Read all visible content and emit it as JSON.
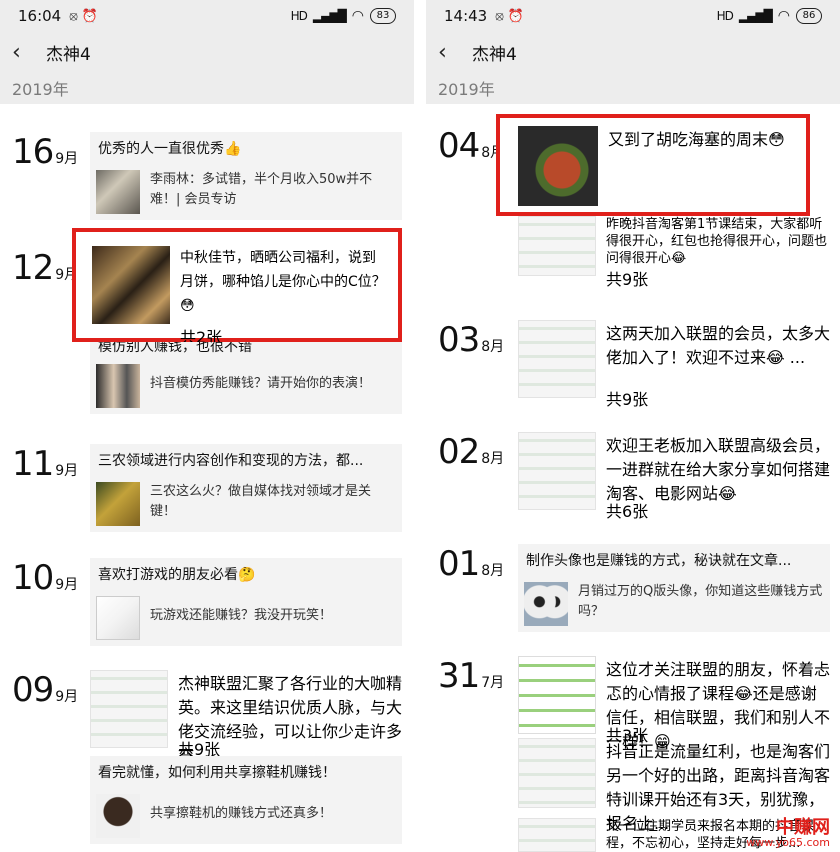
{
  "left": {
    "status": {
      "time": "16:04",
      "battery": "83",
      "net": "HD"
    },
    "nav": {
      "title": "杰神4"
    },
    "year": "2019年",
    "posts": [
      {
        "day": "16",
        "month": "9月",
        "title": "优秀的人一直很优秀👍",
        "share_text": "李雨林：多试错，半个月收入50w并不难！| 会员专访"
      },
      {
        "day": "12",
        "month": "9月",
        "text": "中秋佳节，晒晒公司福利，说到月饼，哪种馅儿是你心中的C位？😳",
        "count": "共2张"
      },
      {
        "title": "模仿别人赚钱，也很不错",
        "share_text": "抖音模仿秀能赚钱？请开始你的表演！"
      },
      {
        "day": "11",
        "month": "9月",
        "title": "三农领域进行内容创作和变现的方法，都...",
        "share_text": "三农这么火？做自媒体找对领域才是关键！"
      },
      {
        "day": "10",
        "month": "9月",
        "title": "喜欢打游戏的朋友必看🤔",
        "share_text": "玩游戏还能赚钱？我没开玩笑！"
      },
      {
        "day": "09",
        "month": "9月",
        "text": "杰神联盟汇聚了各行业的大咖精英。来这里结识优质人脉，与大佬交流经验，可以让你少走许多弯...",
        "count": "共9张"
      },
      {
        "title": "看完就懂，如何利用共享擦鞋机赚钱！",
        "share_text": "共享擦鞋机的赚钱方式还真多！"
      }
    ]
  },
  "right": {
    "status": {
      "time": "14:43",
      "battery": "86",
      "net": "HD"
    },
    "nav": {
      "title": "杰神4"
    },
    "year": "2019年",
    "posts": [
      {
        "day": "04",
        "month": "8月",
        "text": "又到了胡吃海塞的周末😳"
      },
      {
        "text": "昨晚抖音淘客第1节课结束，大家都听得很开心，红包也抢得很开心，问题也问得很开心😂",
        "count": "共9张"
      },
      {
        "day": "03",
        "month": "8月",
        "text": "这两天加入联盟的会员，太多大佬加入了！欢迎不过来😂 ...",
        "count": "共9张"
      },
      {
        "day": "02",
        "month": "8月",
        "text": "欢迎王老板加入联盟高级会员，一进群就在给大家分享如何搭建淘客、电影网站😂",
        "count": "共6张"
      },
      {
        "day": "01",
        "month": "8月",
        "title": "制作头像也是赚钱的方式，秘诀就在文章...",
        "share_text": "月销过万的Q版头像，你知道这些赚钱方式吗？"
      },
      {
        "day": "31",
        "month": "7月",
        "text": "这位才关注联盟的朋友，怀着忐忑的心情报了课程😂还是感谢信任，相信联盟，我们和别人不一样！😁",
        "count": "共3张"
      },
      {
        "text": "抖音正是流量红利，也是淘客们另一个好的出路，距离抖音淘客特训课开始还有3天，别犹豫，报名上..."
      },
      {
        "text": "又一位往期学员来报名本期的抖音课程，不忘初心，坚持走好每一步..."
      }
    ]
  },
  "watermark": {
    "line1": "中赚网",
    "line2": "www.yo65.com"
  },
  "colors": {
    "highlight": "#e0201b",
    "background_gray": "#ededed",
    "card_gray": "#f3f3f3"
  }
}
